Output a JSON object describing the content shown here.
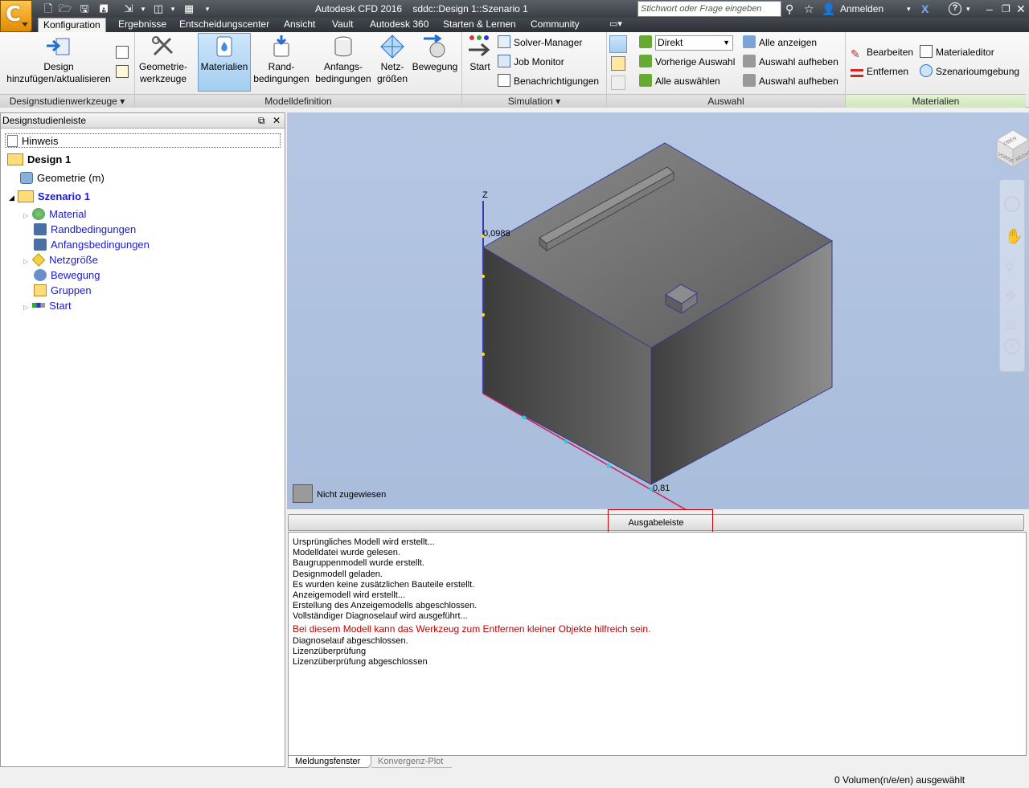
{
  "titlebar": {
    "app_title": "Autodesk CFD 2016",
    "doc_title": "sddc::Design 1::Szenario 1",
    "search_placeholder": "Stichwort oder Frage eingeben",
    "signin": "Anmelden"
  },
  "tabs": [
    "Konfiguration",
    "Ergebnisse",
    "Entscheidungscenter",
    "Ansicht",
    "Vault",
    "Autodesk 360",
    "Starten & Lernen",
    "Community"
  ],
  "ribbon": {
    "designstudie": {
      "title": "Designstudienwerkzeuge",
      "btn1_l1": "Design",
      "btn1_l2": "hinzufügen/aktualisieren"
    },
    "modelldef": {
      "title": "Modelldefinition",
      "geo_l1": "Geometrie-",
      "geo_l2": "werkzeuge",
      "mat": "Materialien",
      "rand_l1": "Rand-",
      "rand_l2": "bedingungen",
      "anf_l1": "Anfangs-",
      "anf_l2": "bedingungen",
      "netz_l1": "Netz-",
      "netz_l2": "größen",
      "beweg": "Bewegung"
    },
    "simulation": {
      "title": "Simulation",
      "start": "Start",
      "solver": "Solver-Manager",
      "job": "Job Monitor",
      "notify": "Benachrichtigungen"
    },
    "auswahl": {
      "title": "Auswahl",
      "mode": "Direkt",
      "prev": "Vorherige Auswahl",
      "all": "Alle auswählen",
      "show_all": "Alle anzeigen",
      "deselect1": "Auswahl aufheben",
      "deselect2": "Auswahl aufheben"
    },
    "materialien": {
      "title": "Materialien",
      "edit": "Bearbeiten",
      "remove": "Entfernen",
      "editor": "Materialeditor",
      "env": "Szenarioumgebung"
    }
  },
  "leftpanel": {
    "title": "Designstudienleiste",
    "hint": "Hinweis",
    "design": "Design 1",
    "geometry": "Geometrie (m)",
    "scenario": "Szenario 1",
    "items": [
      "Material",
      "Randbedingungen",
      "Anfangsbedingungen",
      "Netzgröße",
      "Bewegung",
      "Gruppen",
      "Start"
    ]
  },
  "viewport": {
    "axis_z": "Z",
    "z_value": "0,0988",
    "x_value": "0,81",
    "legend": "Nicht zugewiesen",
    "viewcube": [
      "OBEN",
      "VORNE",
      "RECHTS"
    ]
  },
  "output": {
    "header": "Ausgabeleiste",
    "lines": [
      "Ursprüngliches Modell wird erstellt...",
      "Modelldatei wurde gelesen.",
      "Baugruppenmodell wurde erstellt.",
      "Designmodell geladen.",
      "Es wurden keine zusätzlichen Bauteile erstellt.",
      "Anzeigemodell wird erstellt...",
      "Erstellung des Anzeigemodells abgeschlossen.",
      "Vollständiger Diagnoselauf wird ausgeführt...",
      "Bei diesem Modell kann das Werkzeug zum Entfernen kleiner Objekte hilfreich sein.",
      "Diagnoselauf abgeschlossen.",
      "Lizenzüberprüfung",
      "Lizenzüberprüfung abgeschlossen"
    ],
    "tabs": [
      "Meldungsfenster",
      "Konvergenz-Plot"
    ]
  },
  "status": "0 Volumen(n/e/en) ausgewählt"
}
